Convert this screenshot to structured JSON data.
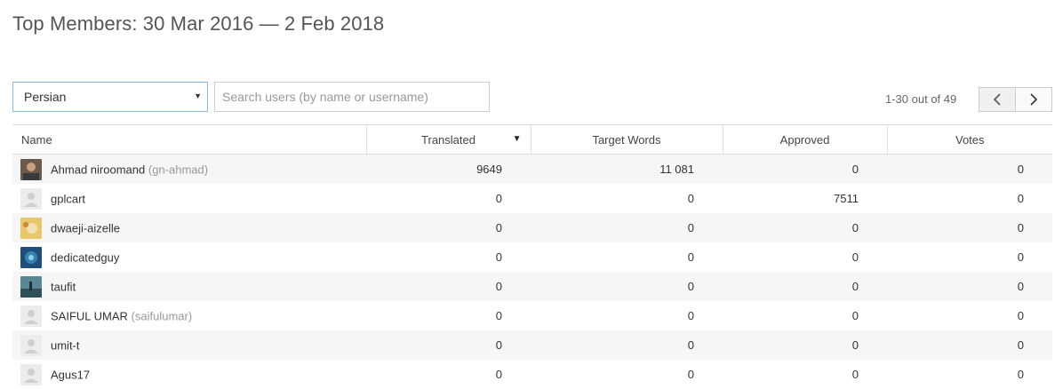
{
  "page_title": "Top Members: 30 Mar 2016 — 2 Feb 2018",
  "language_select": {
    "value": "Persian"
  },
  "search": {
    "placeholder": "Search users (by name or username)"
  },
  "paging": {
    "text": "1-30 out of 49"
  },
  "table": {
    "columns": [
      "Name",
      "Translated",
      "Target Words",
      "Approved",
      "Votes"
    ],
    "rows": [
      {
        "name": "Ahmad niroomand",
        "login": "(gn-ahmad)",
        "avatar": "photo-dark",
        "translated": "9649",
        "target_words": "11 081",
        "approved": "0",
        "votes": "0"
      },
      {
        "name": "gplcart",
        "login": "",
        "avatar": "default",
        "translated": "0",
        "target_words": "0",
        "approved": "7511",
        "votes": "0"
      },
      {
        "name": "dwaeji-aizelle",
        "login": "",
        "avatar": "photo-yellow",
        "translated": "0",
        "target_words": "0",
        "approved": "0",
        "votes": "0"
      },
      {
        "name": "dedicatedguy",
        "login": "",
        "avatar": "photo-blue",
        "translated": "0",
        "target_words": "0",
        "approved": "0",
        "votes": "0"
      },
      {
        "name": "taufit",
        "login": "",
        "avatar": "photo-teal",
        "translated": "0",
        "target_words": "0",
        "approved": "0",
        "votes": "0"
      },
      {
        "name": "SAIFUL UMAR",
        "login": "(saifulumar)",
        "avatar": "default",
        "translated": "0",
        "target_words": "0",
        "approved": "0",
        "votes": "0"
      },
      {
        "name": "umit-t",
        "login": "",
        "avatar": "default",
        "translated": "0",
        "target_words": "0",
        "approved": "0",
        "votes": "0"
      },
      {
        "name": "Agus17",
        "login": "",
        "avatar": "default",
        "translated": "0",
        "target_words": "0",
        "approved": "0",
        "votes": "0"
      }
    ]
  },
  "colors": {
    "select_border": "#8fb6d8",
    "row_stripe": "#f6f6f6",
    "border": "#dddddd"
  }
}
